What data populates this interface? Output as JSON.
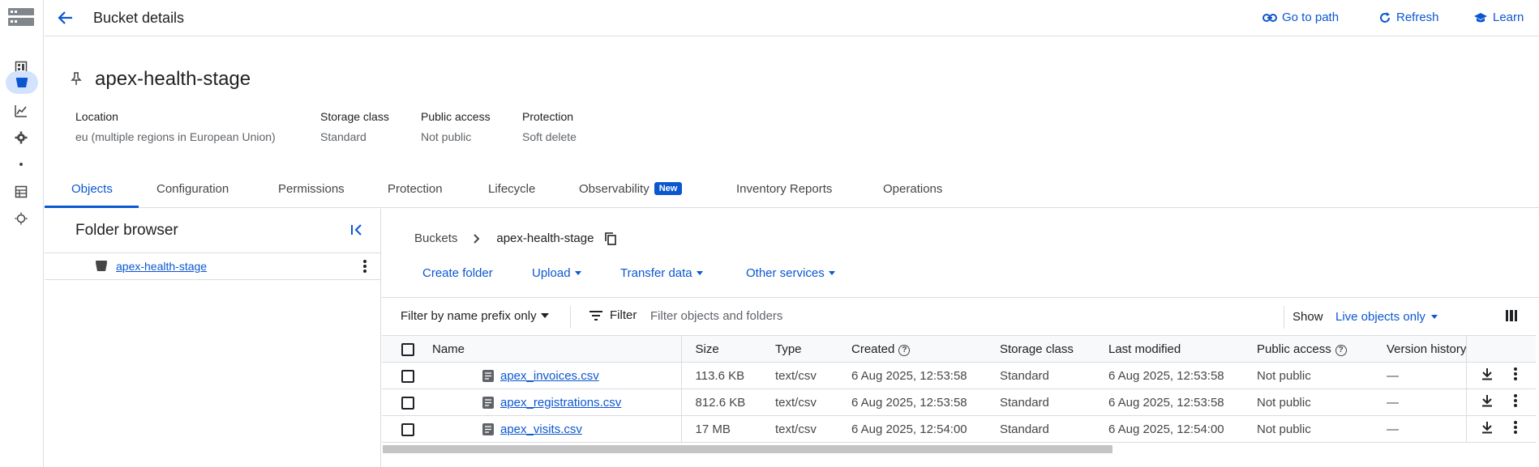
{
  "colors": {
    "accent": "#0b57d0",
    "active_nav_bg": "#d3e3fd",
    "badge_bg": "#0b57d0"
  },
  "header": {
    "title": "Bucket details",
    "actions": [
      {
        "label": "Go to path",
        "icon": "link-icon"
      },
      {
        "label": "Refresh",
        "icon": "refresh-icon"
      },
      {
        "label": "Learn",
        "icon": "school-icon"
      }
    ]
  },
  "bucket": {
    "name": "apex-health-stage",
    "meta": [
      {
        "key": "Location",
        "value": "eu (multiple regions in European Union)"
      },
      {
        "key": "Storage class",
        "value": "Standard"
      },
      {
        "key": "Public access",
        "value": "Not public"
      },
      {
        "key": "Protection",
        "value": "Soft delete"
      }
    ]
  },
  "tabs": [
    {
      "label": "Objects",
      "active": true
    },
    {
      "label": "Configuration"
    },
    {
      "label": "Permissions"
    },
    {
      "label": "Protection"
    },
    {
      "label": "Lifecycle"
    },
    {
      "label": "Observability",
      "badge": "New"
    },
    {
      "label": "Inventory Reports"
    },
    {
      "label": "Operations"
    }
  ],
  "folder_browser": {
    "title": "Folder browser",
    "items": [
      {
        "label": "apex-health-stage"
      }
    ]
  },
  "breadcrumb": {
    "root": "Buckets",
    "current": "apex-health-stage"
  },
  "toolbar": {
    "create_folder": "Create folder",
    "upload": "Upload",
    "transfer_data": "Transfer data",
    "other_services": "Other services"
  },
  "filter_bar": {
    "mode": "Filter by name prefix only",
    "filter_label": "Filter",
    "placeholder": "Filter objects and folders",
    "show_label": "Show",
    "show_value": "Live objects only"
  },
  "table": {
    "headers": {
      "name": "Name",
      "size": "Size",
      "type": "Type",
      "created": "Created",
      "storage_class": "Storage class",
      "last_modified": "Last modified",
      "public_access": "Public access",
      "version_history": "Version history"
    },
    "rows": [
      {
        "name": "apex_invoices.csv",
        "size": "113.6 KB",
        "type": "text/csv",
        "created": "6 Aug 2025, 12:53:58",
        "storage_class": "Standard",
        "last_modified": "6 Aug 2025, 12:53:58",
        "public_access": "Not public",
        "version_history": "—"
      },
      {
        "name": "apex_registrations.csv",
        "size": "812.6 KB",
        "type": "text/csv",
        "created": "6 Aug 2025, 12:53:58",
        "storage_class": "Standard",
        "last_modified": "6 Aug 2025, 12:53:58",
        "public_access": "Not public",
        "version_history": "—"
      },
      {
        "name": "apex_visits.csv",
        "size": "17 MB",
        "type": "text/csv",
        "created": "6 Aug 2025, 12:54:00",
        "storage_class": "Standard",
        "last_modified": "6 Aug 2025, 12:54:00",
        "public_access": "Not public",
        "version_history": "—"
      }
    ]
  }
}
